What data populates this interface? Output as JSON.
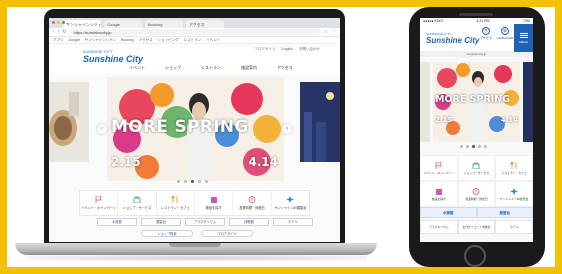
{
  "browser": {
    "tabs": [
      "サンシャインシティ",
      "Google",
      "Booking",
      "アクセス"
    ],
    "url": "https://sunshinecity.jp",
    "bookmarks": [
      "アプリ",
      "Google",
      "サンシャインシティ",
      "Booking",
      "アクセス",
      "ショッピング",
      "レストラン",
      "イベント"
    ]
  },
  "site": {
    "logo_sub": "SUNSHINE CITY",
    "logo_main": "Sunshine City",
    "nav": [
      "イベント",
      "ショップ",
      "レストラン",
      "施設案内",
      "アクセス"
    ],
    "util": [
      "フロアガイド",
      "English",
      "お問い合わせ"
    ]
  },
  "hero": {
    "headline": "MORE SPRING",
    "date_start": "2.15",
    "date_end": "4.14",
    "slides_total": 5,
    "slide_active": 3
  },
  "quick_menu": [
    {
      "icon": "flag-icon",
      "label": "イベント・キャンペーン"
    },
    {
      "icon": "shopping-icon",
      "label": "ショップ・サービス"
    },
    {
      "icon": "restaurant-icon",
      "label": "レストラン・カフェ"
    },
    {
      "icon": "building-icon",
      "label": "施設を探す"
    },
    {
      "icon": "info-icon",
      "label": "営業時間・休館日"
    },
    {
      "icon": "sparkle-icon",
      "label": "サンシャイン60展望台"
    }
  ],
  "link_row": [
    "水族館",
    "展望台",
    "プラネタリウム",
    "博物館",
    "ホテル"
  ],
  "pill_row": [
    "ショップ検索",
    "フロアガイド"
  ],
  "phone": {
    "carrier": "●●●●● KDDI",
    "time": "4:21 PM",
    "battery": "73%",
    "url": "sunshinecity.jp",
    "header_icons": [
      {
        "glyph": "⦿",
        "label": "アクセス"
      },
      {
        "glyph": "⊕",
        "label": "LANGUAGE"
      }
    ],
    "menu_label": "MENU",
    "headline": "MORE SPRING",
    "date_start": "2.15",
    "date_end": "4.14",
    "grid": [
      {
        "icon": "flag-icon",
        "label": "イベント・キャンペーン"
      },
      {
        "icon": "shopping-icon",
        "label": "ショップ・サービス"
      },
      {
        "icon": "restaurant-icon",
        "label": "レストラン・カフェ"
      },
      {
        "icon": "building-icon",
        "label": "施設を探す"
      },
      {
        "icon": "info-icon",
        "label": "営業時間・休館日"
      },
      {
        "icon": "sparkle-icon",
        "label": "サンシャイン60展望台"
      }
    ],
    "split": [
      "水族館",
      "展望台"
    ],
    "tri": [
      "プラネタリウム",
      "古代オリエント博物館",
      "ホテル"
    ]
  },
  "colors": {
    "frame": "#f2c200",
    "brand": "#1e63b6"
  }
}
